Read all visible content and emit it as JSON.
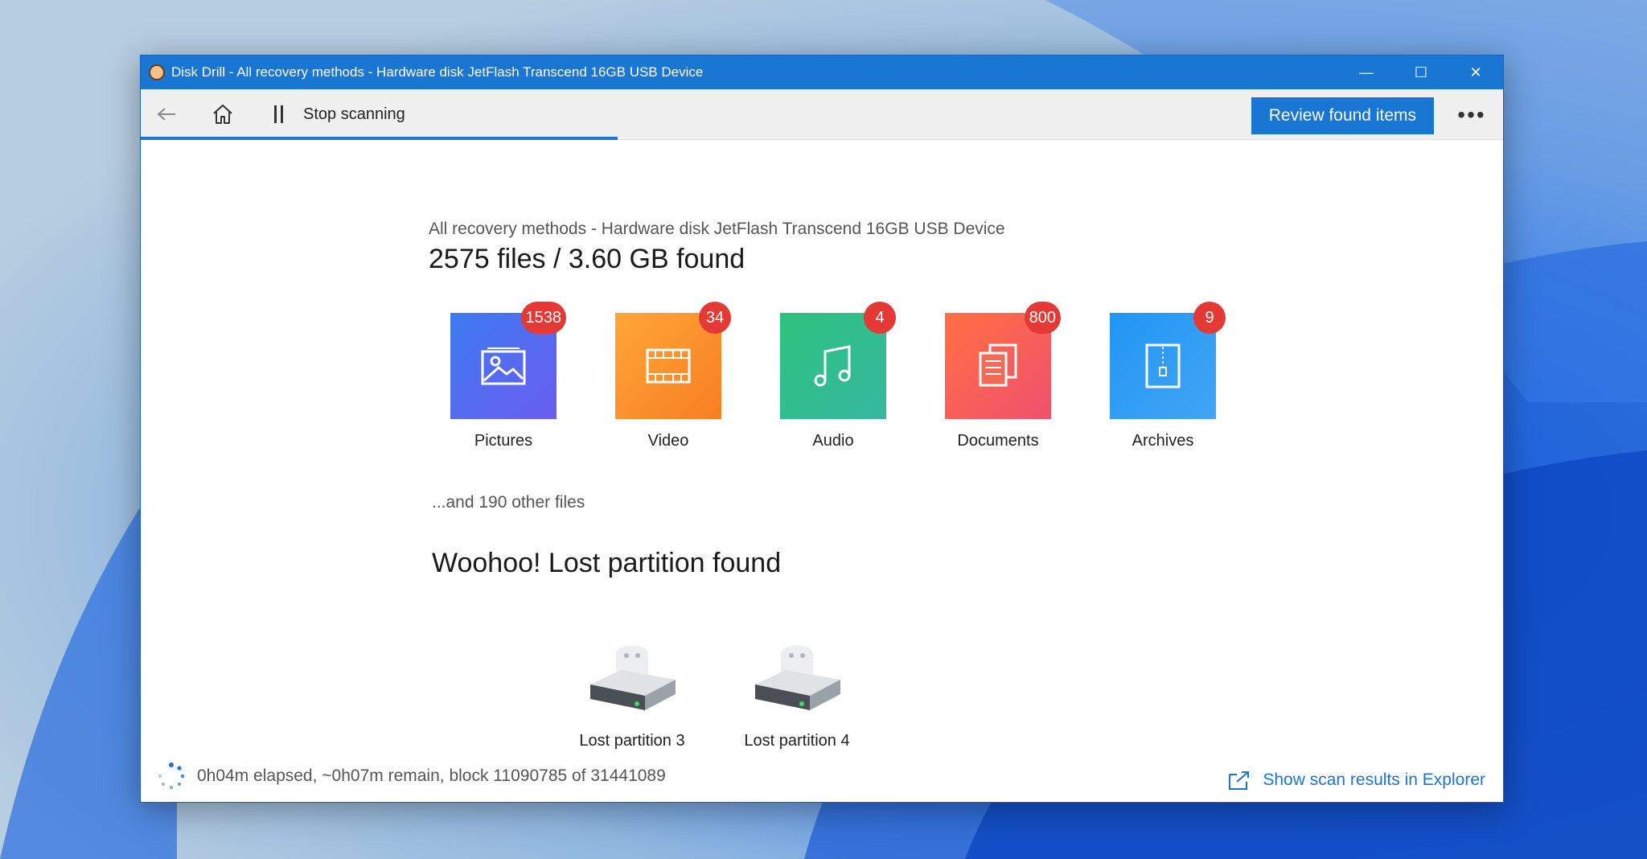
{
  "window": {
    "title": "Disk Drill - All recovery methods - Hardware disk JetFlash Transcend 16GB USB Device",
    "controls": {
      "minimize": "—",
      "maximize": "☐",
      "close": "✕"
    }
  },
  "toolbar": {
    "stop_label": "Stop scanning",
    "review_label": "Review found items",
    "more_label": "•••",
    "scan_progress_fraction": 0.35
  },
  "summary": {
    "subtitle": "All recovery methods - Hardware disk JetFlash Transcend 16GB USB Device",
    "headline": "2575 files / 3.60 GB found"
  },
  "categories": [
    {
      "label": "Pictures",
      "count": "1538",
      "icon": "image-icon",
      "color_from": "#3d7bf0",
      "color_to": "#6b5cf0"
    },
    {
      "label": "Video",
      "count": "34",
      "icon": "film-icon",
      "color_from": "#ffa638",
      "color_to": "#f77e22"
    },
    {
      "label": "Audio",
      "count": "4",
      "icon": "music-note-icon",
      "color_from": "#2ec27e",
      "color_to": "#36b8a0"
    },
    {
      "label": "Documents",
      "count": "800",
      "icon": "documents-icon",
      "color_from": "#ff7043",
      "color_to": "#f0506e"
    },
    {
      "label": "Archives",
      "count": "9",
      "icon": "archive-icon",
      "color_from": "#2196f3",
      "color_to": "#42a5f5"
    }
  ],
  "other_files": "...and 190 other files",
  "lost_partitions": {
    "title": "Woohoo! Lost partition found",
    "items": [
      {
        "label": "Lost partition 3"
      },
      {
        "label": "Lost partition 4"
      }
    ]
  },
  "status": {
    "text": "0h04m elapsed, ~0h07m remain, block 11090785 of 31441089",
    "explorer_link": "Show scan results in Explorer"
  },
  "colors": {
    "accent": "#1976d2",
    "badge": "#e53935"
  }
}
